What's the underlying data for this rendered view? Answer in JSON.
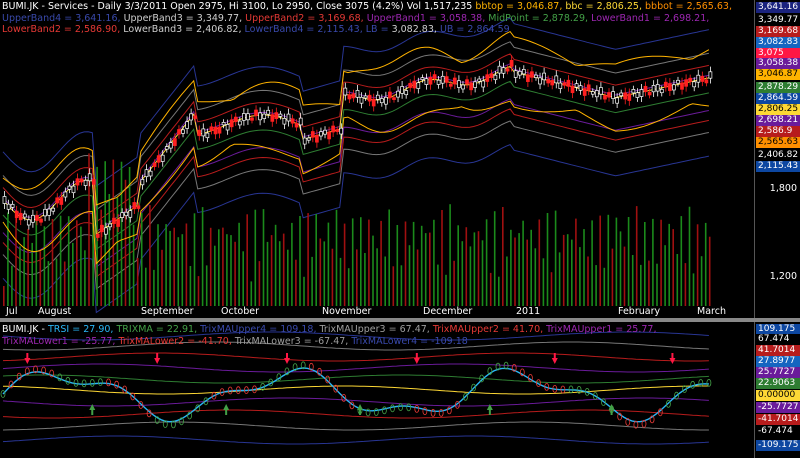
{
  "top_header": {
    "ticker": "BUMI.JK - Services - Daily 3/3/2011",
    "ohlc": "Open 2975, Hi 3100, Lo 2950, Close 3075 (4.2%)",
    "vol": "Vol 1,517,235",
    "bbtop": "bbtop = 3,046.87,",
    "bbc": "bbc = 2,806.25,",
    "bbbot": "bbbot = 2,565.63,",
    "upperband4": "UpperBand4 = 3,641.16,",
    "upperband3": "UpperBand3 = 3,349.77,",
    "upperband2": "UpperBand2 = 3,169.68,",
    "upperband1": "UpperBand1 = 3,058.38,",
    "midpoint": "MidPoint = 2,878.29,",
    "lowerband1": "LowerBand1 = 2,698.21,",
    "lowerband2": "LowerBand2 = 2,586.90,",
    "lowerband3": "LowerBand3 = 2,406.82,",
    "lowerband4": "LowerBand4 = 2,115.43,",
    "lb": "LB =",
    "lb_value": "3,082.83,",
    "ub": "UB = 2,864.59"
  },
  "price_scale": [
    {
      "label": "3,641.16",
      "bg": "#1a237e",
      "fg": "#ffffff"
    },
    {
      "label": "3,349.77",
      "bg": "#000000",
      "fg": "#ffffff"
    },
    {
      "label": "3,169.68",
      "bg": "#b71c1c",
      "fg": "#ffffff"
    },
    {
      "label": "3,082.83",
      "bg": "#1565c0",
      "fg": "#ffffff"
    },
    {
      "label": "3,075",
      "bg": "#ff1744",
      "fg": "#ffffff"
    },
    {
      "label": "3,058.38",
      "bg": "#6a1b9a",
      "fg": "#ffffff"
    },
    {
      "label": "3,046.87",
      "bg": "#ffb300",
      "fg": "#000000"
    },
    {
      "label": "2,878.29",
      "bg": "#2e7d32",
      "fg": "#ffffff"
    },
    {
      "label": "2,864.59",
      "bg": "#0d47a1",
      "fg": "#ffffff"
    },
    {
      "label": "2,806.25",
      "bg": "#fdd835",
      "fg": "#000000"
    },
    {
      "label": "2,698.21",
      "bg": "#6a1b9a",
      "fg": "#ffffff"
    },
    {
      "label": "2,586.9",
      "bg": "#b71c1c",
      "fg": "#ffffff"
    },
    {
      "label": "2,565.63",
      "bg": "#ff8f00",
      "fg": "#000000"
    },
    {
      "label": "2,406.82",
      "bg": "#000000",
      "fg": "#ffffff"
    },
    {
      "label": "2,115.43",
      "bg": "#0d47a1",
      "fg": "#ffffff"
    }
  ],
  "price_ticks": [
    "1,800",
    "1,200"
  ],
  "date_labels": [
    "Jul",
    "August",
    "September",
    "October",
    "November",
    "December",
    "2011",
    "February",
    "March"
  ],
  "bottom_header": {
    "ticker": "BUMI.JK -",
    "trsi": "TRSI = 27.90,",
    "trixma": "TRIXMA = 22.91,",
    "trixmaupper4": "TrixMAUpper4 = 109.18,",
    "trixmaupper3": "TrixMAUpper3 = 67.47,",
    "trixmaupper2": "TrixMAUpper2 = 41.70,",
    "trixmaupper1": "TrixMAUpper1 = 25.77,",
    "trixmalower1": "TrixMALower1 = -25.77,",
    "trixmalower2": "TrixMALower2 = -41.70,",
    "trixmalower3": "TrixMALower3 = -67.47,",
    "trixmalower4": "TrixMALower4 = -109.18"
  },
  "osc_scale": [
    {
      "label": "109.175",
      "bg": "#0d47a1",
      "fg": "#ffffff"
    },
    {
      "label": "67.474",
      "bg": "#000000",
      "fg": "#ffffff"
    },
    {
      "label": "41.7014",
      "bg": "#b71c1c",
      "fg": "#ffffff"
    },
    {
      "label": "27.8977",
      "bg": "#1565c0",
      "fg": "#ffffff"
    },
    {
      "label": "25.7727",
      "bg": "#6a1b9a",
      "fg": "#ffffff"
    },
    {
      "label": "22.9063",
      "bg": "#2e7d32",
      "fg": "#ffffff"
    },
    {
      "label": "0.00000",
      "bg": "#fdd835",
      "fg": "#000000"
    },
    {
      "label": "-25.7727",
      "bg": "#6a1b9a",
      "fg": "#ffffff"
    },
    {
      "label": "-41.7014",
      "bg": "#b71c1c",
      "fg": "#ffffff"
    },
    {
      "label": "-67.474",
      "bg": "#000000",
      "fg": "#ffffff"
    },
    {
      "label": "-109.175",
      "bg": "#0d47a1",
      "fg": "#ffffff"
    }
  ],
  "colors": {
    "background": "#000000",
    "up_candle": "#ffffff",
    "down_candle": "#ff2020",
    "volume_up": "#1b8a1b",
    "volume_down": "#a01010",
    "bb": "#ffb300",
    "trsi": "#29b6f6",
    "trixma": "#2e7d32",
    "zero_line": "#fdd835"
  }
}
